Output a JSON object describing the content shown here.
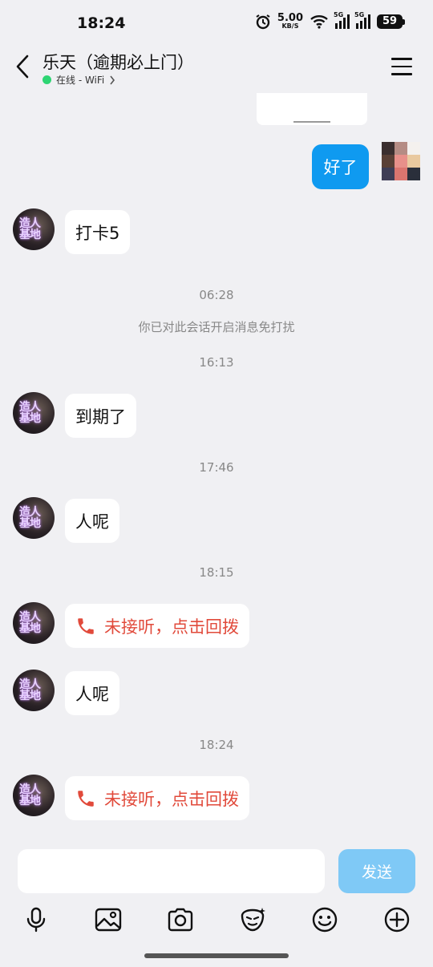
{
  "status_bar": {
    "time": "18:24",
    "net_speed_value": "5.00",
    "net_speed_unit": "KB/S",
    "sim1_tag": "5G",
    "sim2_tag": "5G",
    "battery": "59"
  },
  "header": {
    "title": "乐天（逾期必上门）",
    "status": "在线 - WiFi",
    "status_color": "#2ed573"
  },
  "chat": {
    "my_message": "好了",
    "messages": {
      "m1": "打卡5",
      "m2": "到期了",
      "m3": "人呢",
      "m4": "未接听，点击回拨",
      "m5": "人呢",
      "m6": "未接听，点击回拨"
    },
    "system": {
      "t1": "06:28",
      "notice": "你已对此会话开启消息免打扰",
      "t2": "16:13",
      "t3": "17:46",
      "t4": "18:15",
      "t5": "18:24"
    },
    "avatar_text": "造人基地"
  },
  "input": {
    "value": "",
    "send_label": "发送"
  },
  "colors": {
    "my_bubble": "#0f9af0",
    "missed_call": "#e14a3b",
    "send_disabled": "#7fc9f6"
  },
  "toolbar_icons": [
    "microphone-icon",
    "image-icon",
    "camera-icon",
    "sticker-icon",
    "emoji-icon",
    "plus-icon"
  ]
}
